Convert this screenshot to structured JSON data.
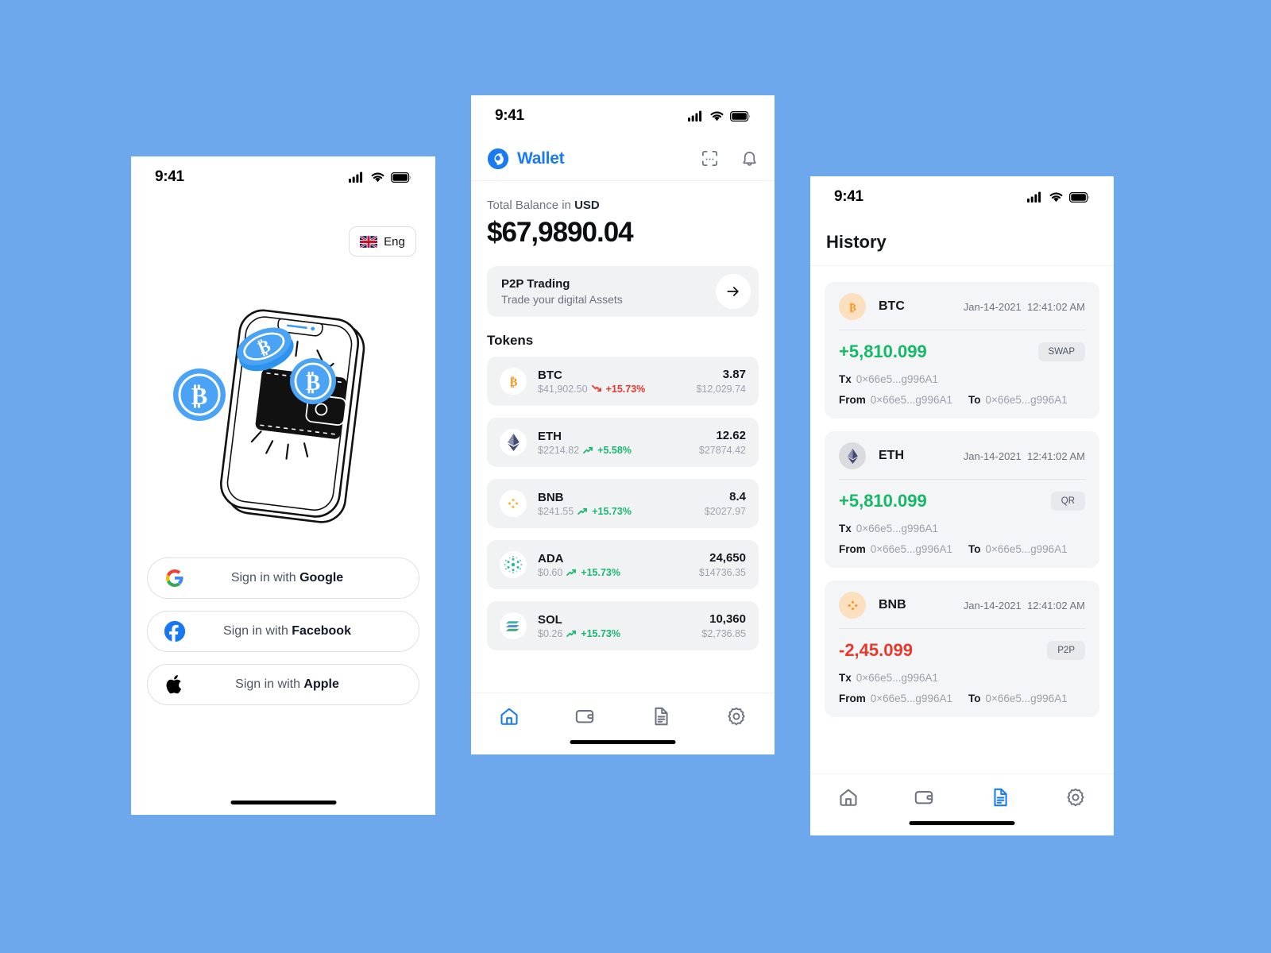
{
  "theme": {
    "background": "#6EA8EC",
    "accent": "#1A7BF0",
    "positive": "#14B866",
    "negative": "#E8382C",
    "card": "#F1F2F4"
  },
  "login_screen": {
    "status_bar": {
      "time": "9:41",
      "icons": [
        "cellular-icon",
        "wifi-icon",
        "battery-icon"
      ]
    },
    "language_selector": {
      "label": "Eng",
      "flag": "uk-flag-icon"
    },
    "illustration": "phone-wallet-bitcoin-illustration",
    "auth_buttons": [
      {
        "prefix": "Sign in with ",
        "brand": "Google",
        "icon": "google-icon"
      },
      {
        "prefix": "Sign in with ",
        "brand": "Facebook",
        "icon": "facebook-icon"
      },
      {
        "prefix": "Sign in with ",
        "brand": "Apple",
        "icon": "apple-icon"
      }
    ]
  },
  "wallet_screen": {
    "status_bar": {
      "time": "9:41"
    },
    "header": {
      "brand": "Wallet",
      "logo": "wallet-logo-icon",
      "actions": [
        "scan-icon",
        "bell-icon"
      ]
    },
    "balance": {
      "label_prefix": "Total Balance in ",
      "currency": "USD",
      "value": "$67,9890.04"
    },
    "p2p_card": {
      "title": "P2P Trading",
      "subtitle": "Trade your digital Assets",
      "arrow": "arrow-right-icon"
    },
    "tokens_section_title": "Tokens",
    "tokens": [
      {
        "symbol": "BTC",
        "price": "$41,902.50",
        "change": "+15.73%",
        "direction": "down",
        "amount": "3.87",
        "value": "$12,029.74",
        "icon": "btc-icon"
      },
      {
        "symbol": "ETH",
        "price": "$2214.82",
        "change": "+5.58%",
        "direction": "up",
        "amount": "12.62",
        "value": "$27874.42",
        "icon": "eth-icon"
      },
      {
        "symbol": "BNB",
        "price": "$241.55",
        "change": "+15.73%",
        "direction": "up",
        "amount": "8.4",
        "value": "$2027.97",
        "icon": "bnb-icon"
      },
      {
        "symbol": "ADA",
        "price": "$0.60",
        "change": "+15.73%",
        "direction": "up",
        "amount": "24,650",
        "value": "$14736.35",
        "icon": "ada-icon"
      },
      {
        "symbol": "SOL",
        "price": "$0.26",
        "change": "+15.73%",
        "direction": "up",
        "amount": "10,360",
        "value": "$2,736.85",
        "icon": "sol-icon"
      }
    ],
    "tabbar": [
      {
        "name": "home-icon",
        "active": true
      },
      {
        "name": "wallet-icon",
        "active": false
      },
      {
        "name": "document-icon",
        "active": false
      },
      {
        "name": "gear-icon",
        "active": false
      }
    ]
  },
  "history_screen": {
    "status_bar": {
      "time": "9:41"
    },
    "title": "History",
    "labels": {
      "tx": "Tx",
      "from": "From",
      "to": "To"
    },
    "transactions": [
      {
        "symbol": "BTC",
        "icon": "btc-icon",
        "date": "Jan-14-2021",
        "time": "12:41:02 AM",
        "amount": "+5,810.099",
        "sign": "pos",
        "badge": "SWAP",
        "tx": "0×66e5...g996A1",
        "from": "0×66e5...g996A1",
        "to": "0×66e5...g996A1"
      },
      {
        "symbol": "ETH",
        "icon": "eth-icon",
        "date": "Jan-14-2021",
        "time": "12:41:02 AM",
        "amount": "+5,810.099",
        "sign": "pos",
        "badge": "QR",
        "tx": "0×66e5...g996A1",
        "from": "0×66e5...g996A1",
        "to": "0×66e5...g996A1"
      },
      {
        "symbol": "BNB",
        "icon": "bnb-icon",
        "date": "Jan-14-2021",
        "time": "12:41:02 AM",
        "amount": "-2,45.099",
        "sign": "neg",
        "badge": "P2P",
        "tx": "0×66e5...g996A1",
        "from": "0×66e5...g996A1",
        "to": "0×66e5...g996A1"
      }
    ],
    "tabbar": [
      {
        "name": "home-icon",
        "active": false
      },
      {
        "name": "wallet-icon",
        "active": false
      },
      {
        "name": "document-icon",
        "active": true
      },
      {
        "name": "gear-icon",
        "active": false
      }
    ]
  }
}
